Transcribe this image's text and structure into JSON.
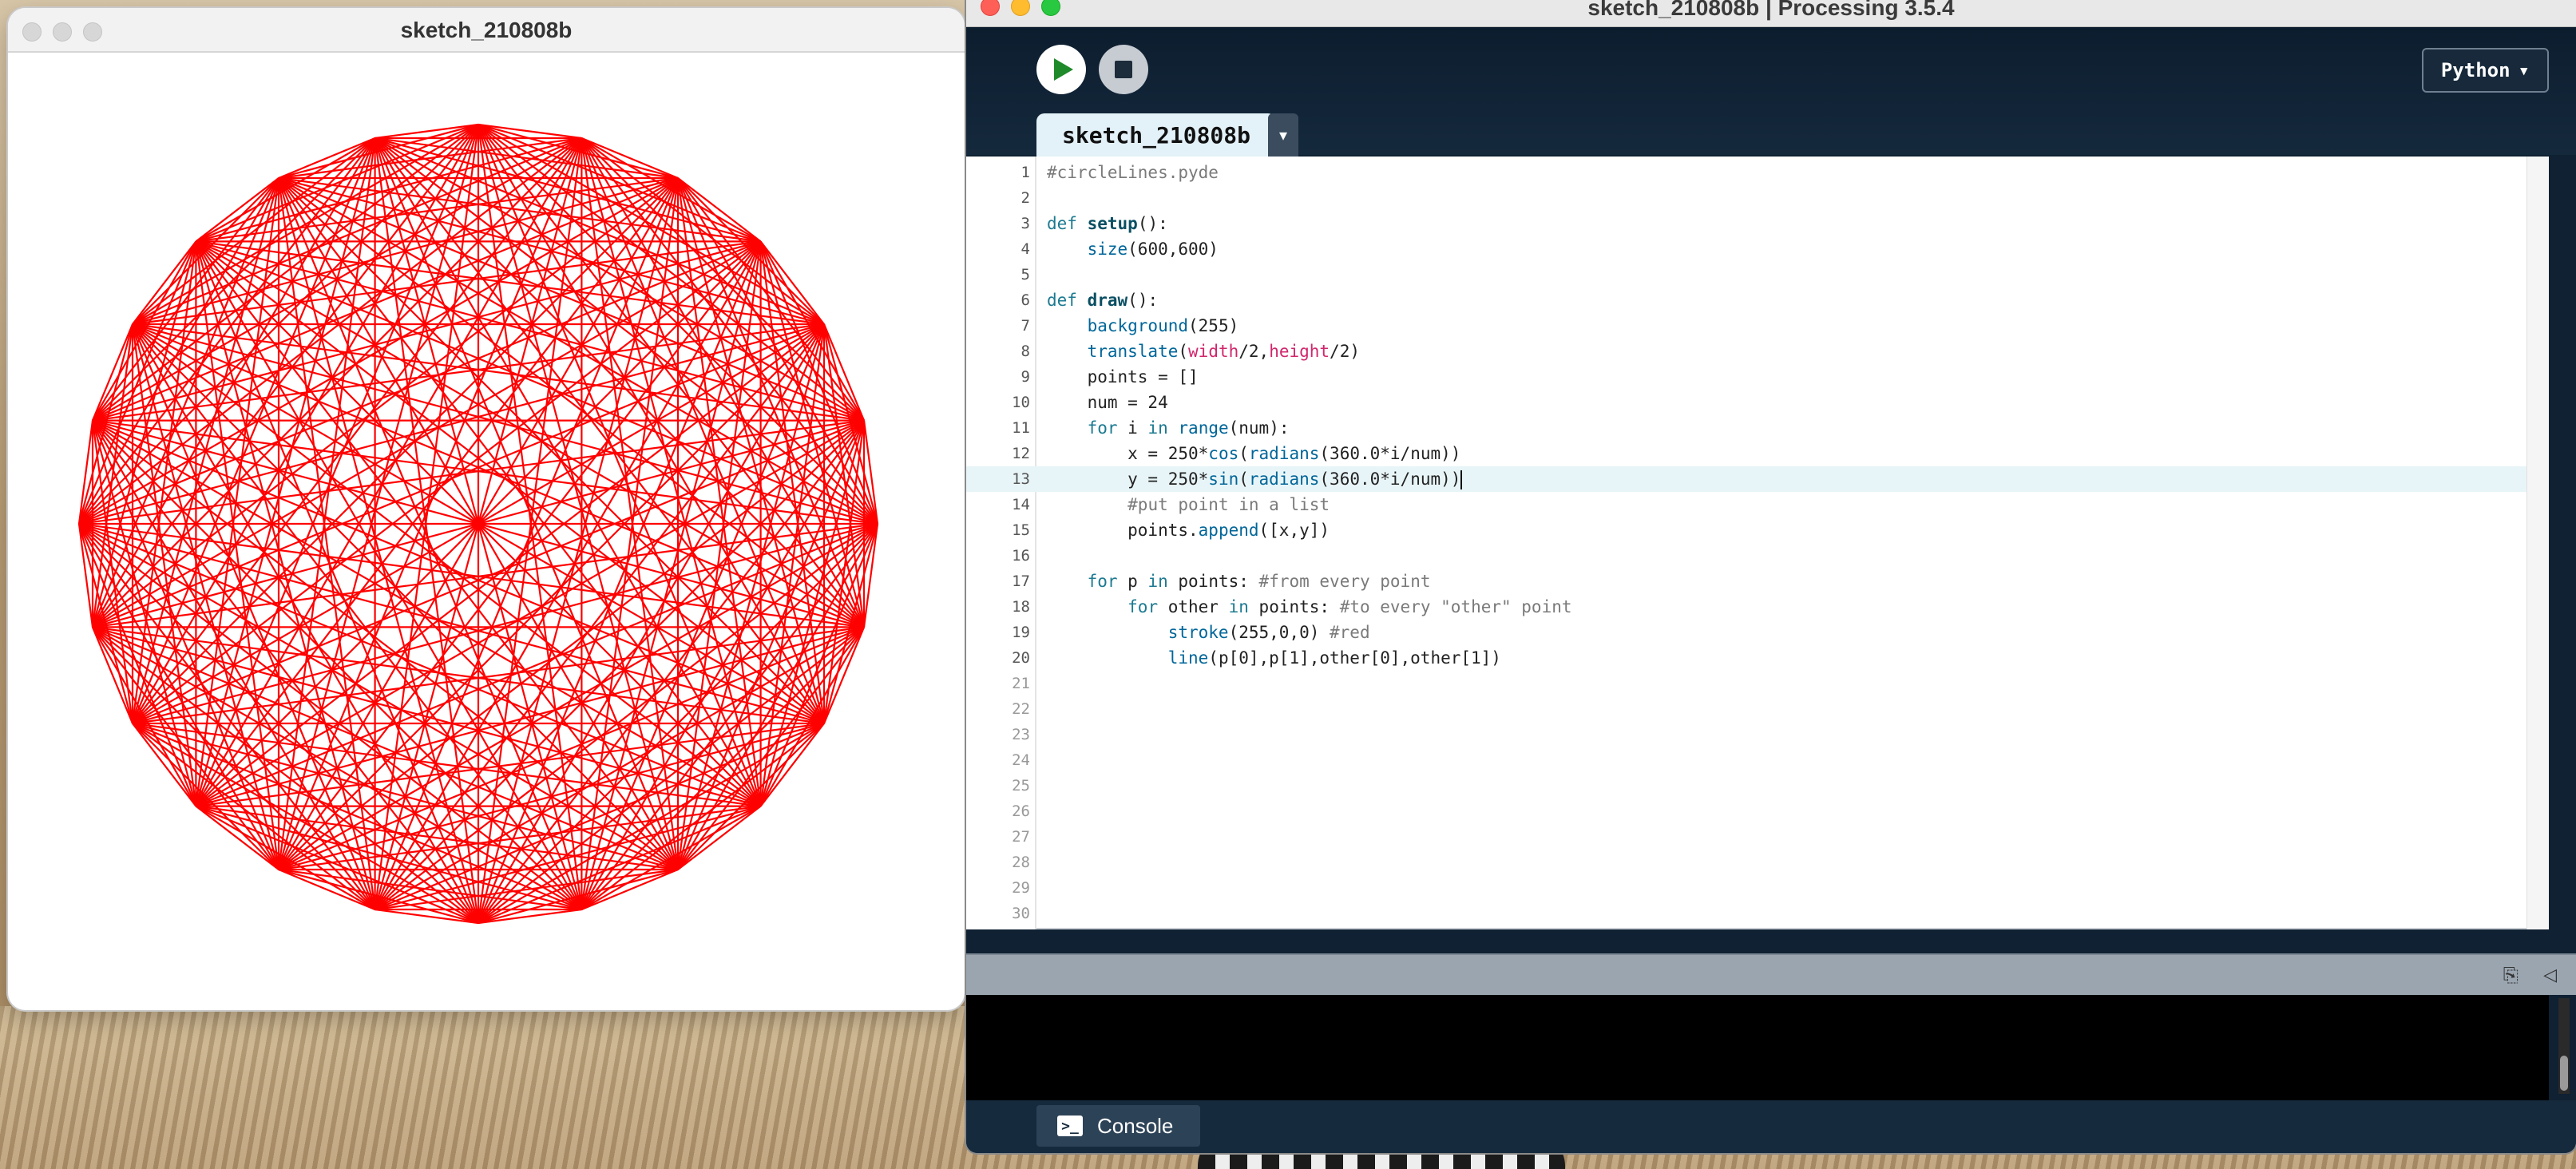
{
  "sketch_window": {
    "title": "sketch_210808b"
  },
  "ide": {
    "title": "sketch_210808b | Processing 3.5.4",
    "mode": "Python",
    "tab": "sketch_210808b",
    "console_tab": "Console",
    "current_line": 13
  },
  "colors": {
    "line_stroke": "#ff0000",
    "editor_bg": "#ffffff",
    "toolbar_bg": "#0f2132"
  },
  "icons": {
    "run": "play-icon",
    "stop": "stop-icon",
    "tab_menu": "chevron-down-icon",
    "copy": "copy-icon",
    "collapse": "collapse-icon",
    "console": "console-icon"
  }
}
